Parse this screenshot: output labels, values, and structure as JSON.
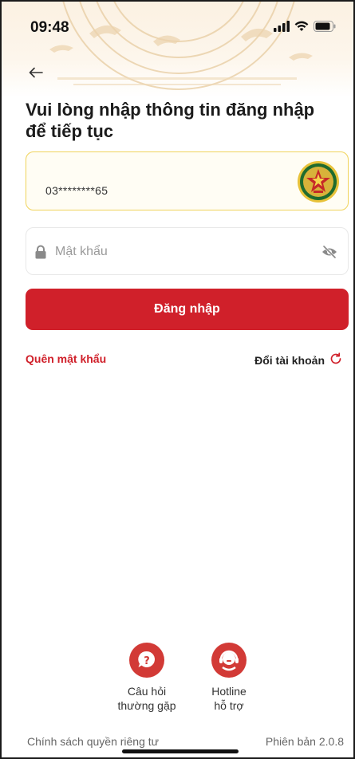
{
  "status_bar": {
    "time": "09:48"
  },
  "login": {
    "title": "Vui lòng nhập thông tin đăng nhập để tiếp tục",
    "phone_value": "03********65",
    "password_placeholder": "Mật khẩu",
    "login_button": "Đăng nhập",
    "forgot_password": "Quên mật khẩu",
    "switch_account": "Đổi tài khoản"
  },
  "support": [
    {
      "label": "Câu hỏi\nthường gặp",
      "icon": "faq-icon"
    },
    {
      "label": "Hotline\nhỗ trợ",
      "icon": "hotline-agent-icon"
    }
  ],
  "footer": {
    "privacy": "Chính sách quyền riêng tư",
    "version": "Phiên bản 2.0.8"
  },
  "colors": {
    "accent": "#d0202a",
    "field_highlight": "#f0d35a",
    "header_tint": "#fbf1e2"
  }
}
